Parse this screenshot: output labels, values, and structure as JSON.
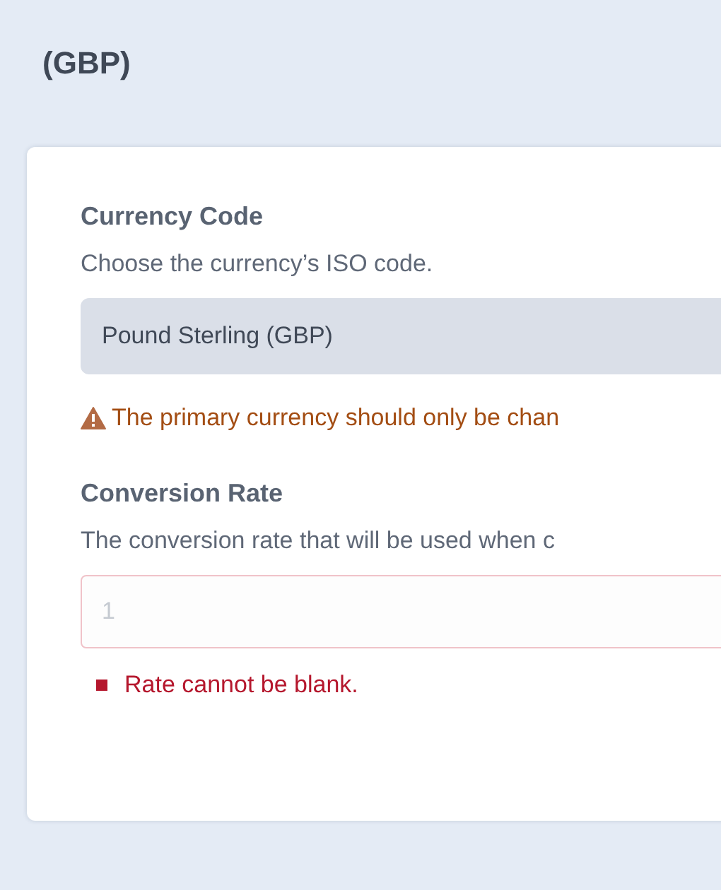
{
  "page_title": "(GBP)",
  "fields": [
    {
      "kind": "select",
      "label": "Currency Code",
      "description": "Choose the currency’s ISO code.",
      "value": "Pound Sterling (GBP)",
      "warning": "The primary currency should only be chan"
    },
    {
      "kind": "input",
      "label": "Conversion Rate",
      "description": "The conversion rate that will be used when c",
      "placeholder": "1",
      "errors": [
        "Rate cannot be blank."
      ]
    }
  ]
}
